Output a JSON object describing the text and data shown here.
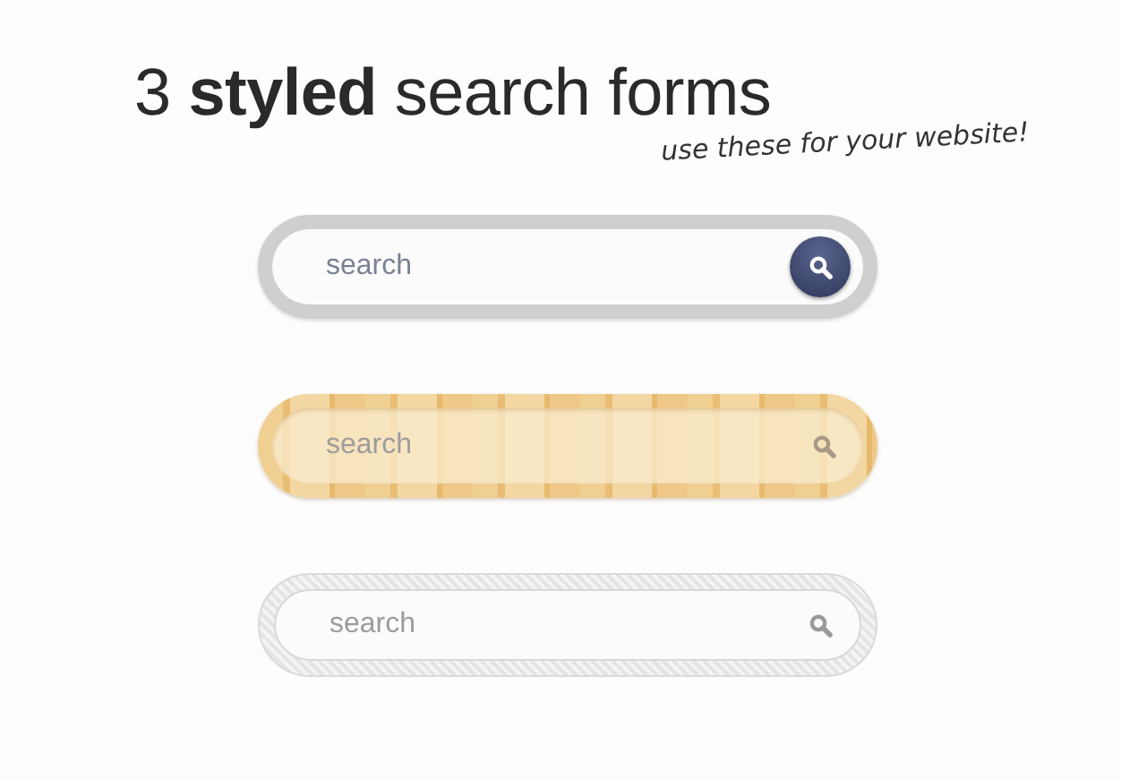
{
  "heading": {
    "title": "3 **styled** search forms",
    "subtitle": "use these for your website!"
  },
  "forms": [
    {
      "kind": "gray",
      "placeholder": "search"
    },
    {
      "kind": "wood",
      "placeholder": "search"
    },
    {
      "kind": "mesh",
      "placeholder": "search"
    }
  ]
}
